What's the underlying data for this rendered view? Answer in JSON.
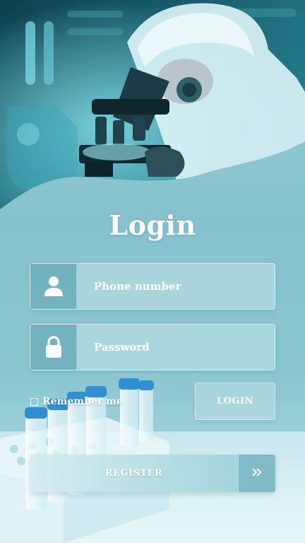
{
  "title": "Login",
  "fields": {
    "phone": {
      "placeholder": "Phone number",
      "value": "",
      "icon": "user-icon"
    },
    "password": {
      "placeholder": "Password",
      "value": "",
      "icon": "lock-icon"
    }
  },
  "remember": {
    "label": "Remember me",
    "checked": false
  },
  "buttons": {
    "login": "LOGIN",
    "register": "REGISTER",
    "register_arrow_icon": "double-chevron-right-icon"
  },
  "colors": {
    "background": "#8ec8d2",
    "icon_box": "#5fa8b6",
    "accent": "#7fbcc7",
    "text": "#ffffff"
  }
}
